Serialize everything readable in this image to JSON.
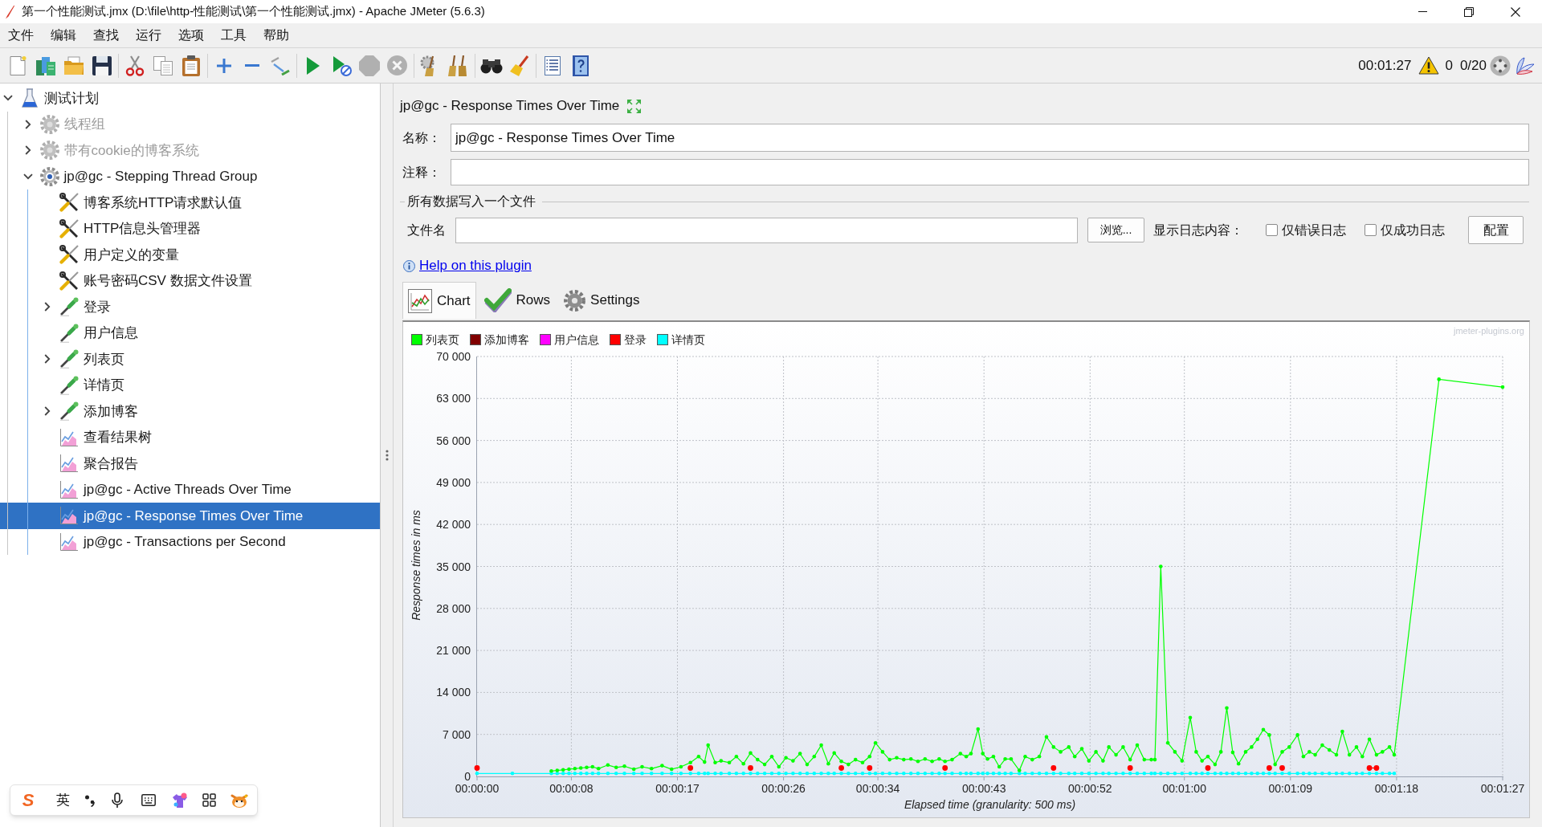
{
  "window": {
    "title": "第一个性能测试.jmx (D:\\file\\http-性能测试\\第一个性能测试.jmx) - Apache JMeter (5.6.3)"
  },
  "menu": [
    "文件",
    "编辑",
    "查找",
    "运行",
    "选项",
    "工具",
    "帮助"
  ],
  "toolbar": {
    "buttons": [
      {
        "disabled": false
      },
      {
        "disabled": false
      },
      {
        "disabled": false
      },
      {
        "disabled": false
      },
      {
        "disabled": false
      },
      {
        "disabled": false
      },
      {
        "disabled": false
      },
      {
        "disabled": false
      },
      {
        "disabled": false
      },
      {
        "disabled": false
      },
      {
        "disabled": false
      },
      {
        "disabled": false
      },
      {
        "disabled": true
      },
      {
        "disabled": true
      },
      {
        "disabled": false
      },
      {
        "disabled": false
      },
      {
        "disabled": false
      },
      {
        "disabled": false
      },
      {
        "disabled": false
      },
      {
        "disabled": false
      }
    ]
  },
  "status": {
    "elapsed": "00:01:27",
    "errors": "0",
    "threads": "0/20"
  },
  "tree": [
    {
      "label": "测试计划",
      "kind": "plan",
      "expanded": true,
      "selected": false,
      "disabled": false,
      "children": [
        {
          "label": "线程组",
          "kind": "thread_group",
          "expanded": false,
          "selected": false,
          "disabled": true
        },
        {
          "label": "带有cookie的博客系统",
          "kind": "thread_group",
          "expanded": false,
          "selected": false,
          "disabled": true
        },
        {
          "label": "jp@gc - Stepping Thread Group",
          "kind": "stepping_thread_group",
          "expanded": true,
          "selected": false,
          "disabled": false,
          "children": [
            {
              "label": "博客系统HTTP请求默认值",
              "kind": "config",
              "selected": false,
              "disabled": false
            },
            {
              "label": "HTTP信息头管理器",
              "kind": "config",
              "selected": false,
              "disabled": false
            },
            {
              "label": "用户定义的变量",
              "kind": "config",
              "selected": false,
              "disabled": false
            },
            {
              "label": "账号密码CSV 数据文件设置",
              "kind": "config",
              "selected": false,
              "disabled": false
            },
            {
              "label": "登录",
              "kind": "sampler",
              "expanded": false,
              "selected": false,
              "disabled": false
            },
            {
              "label": "用户信息",
              "kind": "sampler",
              "selected": false,
              "disabled": false
            },
            {
              "label": "列表页",
              "kind": "sampler",
              "expanded": false,
              "selected": false,
              "disabled": false
            },
            {
              "label": "详情页",
              "kind": "sampler",
              "selected": false,
              "disabled": false
            },
            {
              "label": "添加博客",
              "kind": "sampler",
              "expanded": false,
              "selected": false,
              "disabled": false
            },
            {
              "label": "查看结果树",
              "kind": "listener",
              "selected": false,
              "disabled": false
            },
            {
              "label": "聚合报告",
              "kind": "listener",
              "selected": false,
              "disabled": false
            },
            {
              "label": "jp@gc - Active Threads Over Time",
              "kind": "listener",
              "selected": false,
              "disabled": false
            },
            {
              "label": "jp@gc - Response Times Over Time",
              "kind": "listener",
              "selected": true,
              "disabled": false
            },
            {
              "label": "jp@gc - Transactions per Second",
              "kind": "listener",
              "selected": false,
              "disabled": false
            }
          ]
        }
      ]
    }
  ],
  "panel": {
    "title": "jp@gc - Response Times Over Time",
    "name_label": "名称：",
    "name_value": "jp@gc - Response Times Over Time",
    "comment_label": "注释：",
    "file_group_title": "所有数据写入一个文件",
    "file_label": "文件名",
    "browse_button": "浏览...",
    "log_label": "显示日志内容：",
    "checkboxes": [
      {
        "label": "仅错误日志",
        "checked": false
      },
      {
        "label": "仅成功日志",
        "checked": false
      }
    ],
    "config_button": "配置",
    "help_link": "Help on this plugin"
  },
  "tabs": [
    {
      "label": "Chart",
      "selected": true
    },
    {
      "label": "Rows",
      "selected": false
    },
    {
      "label": "Settings",
      "selected": false
    }
  ],
  "chart_panel": {
    "watermark": "jmeter-plugins.org",
    "chart_data": {
      "type": "line",
      "grid": true,
      "legend": "top",
      "xlabel": "Elapsed time (granularity: 500 ms)",
      "ylabel": "Response times in ms",
      "xlim": [
        0,
        87
      ],
      "ylim": [
        0,
        70000
      ],
      "xticks": [
        {
          "value": 0,
          "label": "00:00:00"
        },
        {
          "value": 8,
          "label": "00:00:08"
        },
        {
          "value": 17,
          "label": "00:00:17"
        },
        {
          "value": 26,
          "label": "00:00:26"
        },
        {
          "value": 34,
          "label": "00:00:34"
        },
        {
          "value": 43,
          "label": "00:00:43"
        },
        {
          "value": 52,
          "label": "00:00:52"
        },
        {
          "value": 60,
          "label": "00:01:00"
        },
        {
          "value": 69,
          "label": "00:01:09"
        },
        {
          "value": 78,
          "label": "00:01:18"
        },
        {
          "value": 87,
          "label": "00:01:27"
        }
      ],
      "yticks": [
        {
          "value": 0,
          "label": "0"
        },
        {
          "value": 7000,
          "label": "7 000"
        },
        {
          "value": 14000,
          "label": "14 000"
        },
        {
          "value": 21000,
          "label": "21 000"
        },
        {
          "value": 28000,
          "label": "28 000"
        },
        {
          "value": 35000,
          "label": "35 000"
        },
        {
          "value": 42000,
          "label": "42 000"
        },
        {
          "value": 49000,
          "label": "49 000"
        },
        {
          "value": 56000,
          "label": "56 000"
        },
        {
          "value": 63000,
          "label": "63 000"
        },
        {
          "value": 70000,
          "label": "70 000"
        }
      ],
      "x": [
        0,
        3,
        6.3,
        6.8,
        7.3,
        7.8,
        8.3,
        8.8,
        9.3,
        9.8,
        10.3,
        11.1,
        11.8,
        12.5,
        13.3,
        14.0,
        14.8,
        15.7,
        16.5,
        17.3,
        18.1,
        18.8,
        19.3,
        19.6,
        20.2,
        20.7,
        21.4,
        22.0,
        22.6,
        23.2,
        23.8,
        24.4,
        25.0,
        25.6,
        26.2,
        26.8,
        27.4,
        28.0,
        28.6,
        29.2,
        29.8,
        30.3,
        30.9,
        31.5,
        32.1,
        32.7,
        33.3,
        33.8,
        34.4,
        35.0,
        35.6,
        36.2,
        36.8,
        37.4,
        38.0,
        38.6,
        39.2,
        39.7,
        40.3,
        41.0,
        41.5,
        41.9,
        42.5,
        42.9,
        43.3,
        43.8,
        44.3,
        44.8,
        45.3,
        46.0,
        46.5,
        47.1,
        47.7,
        48.3,
        48.9,
        49.5,
        50.2,
        50.7,
        51.3,
        51.9,
        52.5,
        53.1,
        53.6,
        54.2,
        54.8,
        55.4,
        56.0,
        56.6,
        57.2,
        57.5,
        58.0,
        58.6,
        59.2,
        59.8,
        60.5,
        61.0,
        61.5,
        62.0,
        62.6,
        63.1,
        63.6,
        64.1,
        64.6,
        65.2,
        65.7,
        66.2,
        66.7,
        67.2,
        67.7,
        68.3,
        68.9,
        69.6,
        70.1,
        70.6,
        71.1,
        71.7,
        72.3,
        72.9,
        73.4,
        74.0,
        74.6,
        75.1,
        75.7,
        76.3,
        76.8,
        77.4,
        77.8,
        81.6,
        87.0
      ],
      "series": [
        {
          "name": "列表页",
          "color": "#00ff00",
          "values": [
            null,
            null,
            900,
            1000,
            1100,
            1200,
            1300,
            1400,
            1500,
            1600,
            1300,
            1900,
            1500,
            1700,
            1200,
            1600,
            1300,
            1800,
            1200,
            1600,
            2300,
            3300,
            2400,
            5200,
            2300,
            2600,
            2300,
            3300,
            2100,
            3900,
            2800,
            2000,
            3300,
            1600,
            3100,
            2600,
            3800,
            2000,
            3300,
            5200,
            2100,
            3900,
            2500,
            2000,
            2800,
            2300,
            3300,
            5600,
            4100,
            2800,
            3100,
            2800,
            2900,
            2500,
            2900,
            2500,
            2900,
            2500,
            2800,
            3800,
            3300,
            3800,
            7900,
            3800,
            2900,
            3300,
            1600,
            2900,
            2900,
            1000,
            3300,
            2800,
            3300,
            6600,
            4900,
            4100,
            4900,
            3300,
            4600,
            2600,
            4100,
            2600,
            4900,
            3600,
            4900,
            2800,
            5200,
            2800,
            2800,
            2800,
            35000,
            5600,
            4100,
            2600,
            9800,
            4100,
            2600,
            3300,
            2000,
            4100,
            11400,
            4000,
            2100,
            4100,
            4900,
            6200,
            7800,
            6900,
            2000,
            4100,
            4900,
            6900,
            3300,
            4100,
            3600,
            5200,
            4400,
            3600,
            7500,
            3600,
            4900,
            3300,
            6200,
            3600,
            4100,
            4900,
            3600,
            66200,
            64900
          ]
        },
        {
          "name": "添加博客",
          "color": "#800000",
          "values": [
            null,
            null,
            null,
            null,
            null,
            null,
            null,
            null,
            null,
            null,
            null,
            null,
            null,
            null,
            null,
            null,
            null,
            null,
            null,
            null,
            null,
            null,
            null,
            null,
            null,
            null,
            null,
            null,
            null,
            null,
            null,
            null,
            null,
            null,
            null,
            null,
            null,
            null,
            null,
            null,
            null,
            null,
            null,
            null,
            null,
            null,
            null,
            null,
            null,
            null,
            null,
            null,
            null,
            null,
            null,
            null,
            null,
            null,
            null,
            null,
            null,
            null,
            null,
            null,
            null,
            null,
            null,
            null,
            null,
            null,
            null,
            null,
            null,
            null,
            null,
            null,
            null,
            null,
            null,
            null,
            null,
            null,
            null,
            null,
            null,
            null,
            null,
            null,
            null,
            null,
            null,
            null,
            null,
            null,
            null,
            null,
            null,
            null,
            null,
            null,
            null,
            null,
            null,
            null,
            null,
            null,
            null,
            null,
            null,
            null,
            null,
            null,
            null,
            null,
            null,
            null,
            null,
            null,
            null,
            null,
            null,
            null,
            null,
            null,
            null,
            null,
            null,
            null,
            null
          ]
        },
        {
          "name": "用户信息",
          "color": "#ff00ff",
          "values": [
            null,
            null,
            null,
            null,
            null,
            null,
            null,
            null,
            null,
            null,
            null,
            null,
            null,
            null,
            null,
            null,
            null,
            null,
            null,
            null,
            null,
            null,
            null,
            null,
            null,
            null,
            null,
            null,
            null,
            null,
            null,
            null,
            null,
            null,
            null,
            null,
            null,
            null,
            null,
            null,
            null,
            null,
            null,
            null,
            null,
            null,
            null,
            null,
            null,
            null,
            null,
            null,
            null,
            null,
            null,
            null,
            null,
            null,
            null,
            null,
            null,
            null,
            null,
            null,
            null,
            null,
            null,
            null,
            null,
            null,
            null,
            null,
            null,
            null,
            null,
            null,
            null,
            null,
            null,
            null,
            null,
            null,
            null,
            null,
            null,
            null,
            null,
            null,
            null,
            null,
            null,
            null,
            null,
            null,
            null,
            null,
            null,
            null,
            null,
            null,
            null,
            null,
            null,
            null,
            null,
            null,
            null,
            null,
            null,
            null,
            null,
            null,
            null,
            null,
            null,
            null,
            null,
            null,
            null,
            null,
            null,
            null,
            null,
            null,
            null,
            null,
            null,
            null,
            null
          ]
        },
        {
          "name": "登录",
          "color": "#ff0000",
          "marker": "circle",
          "values": [
            1400,
            null,
            null,
            null,
            null,
            null,
            null,
            null,
            null,
            null,
            null,
            null,
            null,
            null,
            null,
            null,
            null,
            null,
            null,
            null,
            1400,
            null,
            null,
            null,
            null,
            null,
            null,
            null,
            null,
            1400,
            null,
            null,
            null,
            null,
            null,
            null,
            null,
            null,
            null,
            null,
            null,
            null,
            1400,
            null,
            null,
            null,
            1400,
            null,
            null,
            null,
            null,
            null,
            null,
            null,
            null,
            null,
            null,
            1400,
            null,
            null,
            null,
            null,
            null,
            null,
            null,
            null,
            null,
            null,
            null,
            null,
            null,
            null,
            null,
            null,
            1400,
            null,
            null,
            null,
            null,
            null,
            null,
            null,
            null,
            null,
            null,
            1400,
            null,
            null,
            null,
            null,
            null,
            null,
            null,
            null,
            null,
            null,
            null,
            1400,
            null,
            null,
            null,
            null,
            null,
            null,
            null,
            null,
            null,
            1400,
            null,
            1400,
            null,
            null,
            null,
            null,
            null,
            null,
            null,
            null,
            null,
            null,
            null,
            null,
            1400,
            1400,
            null,
            null,
            null,
            null,
            null
          ]
        },
        {
          "name": "详情页",
          "color": "#00ffff",
          "values": [
            500,
            500,
            500,
            500,
            500,
            500,
            500,
            500,
            500,
            500,
            500,
            500,
            500,
            500,
            500,
            500,
            500,
            500,
            500,
            500,
            500,
            500,
            500,
            500,
            500,
            500,
            500,
            500,
            500,
            500,
            500,
            500,
            500,
            500,
            500,
            500,
            500,
            500,
            500,
            500,
            500,
            500,
            500,
            500,
            500,
            500,
            500,
            500,
            500,
            500,
            500,
            500,
            500,
            500,
            500,
            500,
            500,
            500,
            500,
            500,
            500,
            500,
            500,
            500,
            500,
            500,
            500,
            500,
            500,
            500,
            500,
            500,
            500,
            500,
            500,
            500,
            500,
            500,
            500,
            500,
            500,
            500,
            500,
            500,
            500,
            500,
            500,
            500,
            500,
            500,
            500,
            500,
            500,
            500,
            500,
            500,
            500,
            500,
            500,
            500,
            500,
            500,
            500,
            500,
            500,
            500,
            500,
            500,
            500,
            500,
            500,
            500,
            500,
            500,
            500,
            500,
            500,
            500,
            500,
            500,
            500,
            500,
            500,
            500,
            500,
            500,
            500,
            null,
            null
          ]
        }
      ]
    }
  },
  "ime_toolbar": {
    "logo": "S",
    "mode": "英"
  }
}
